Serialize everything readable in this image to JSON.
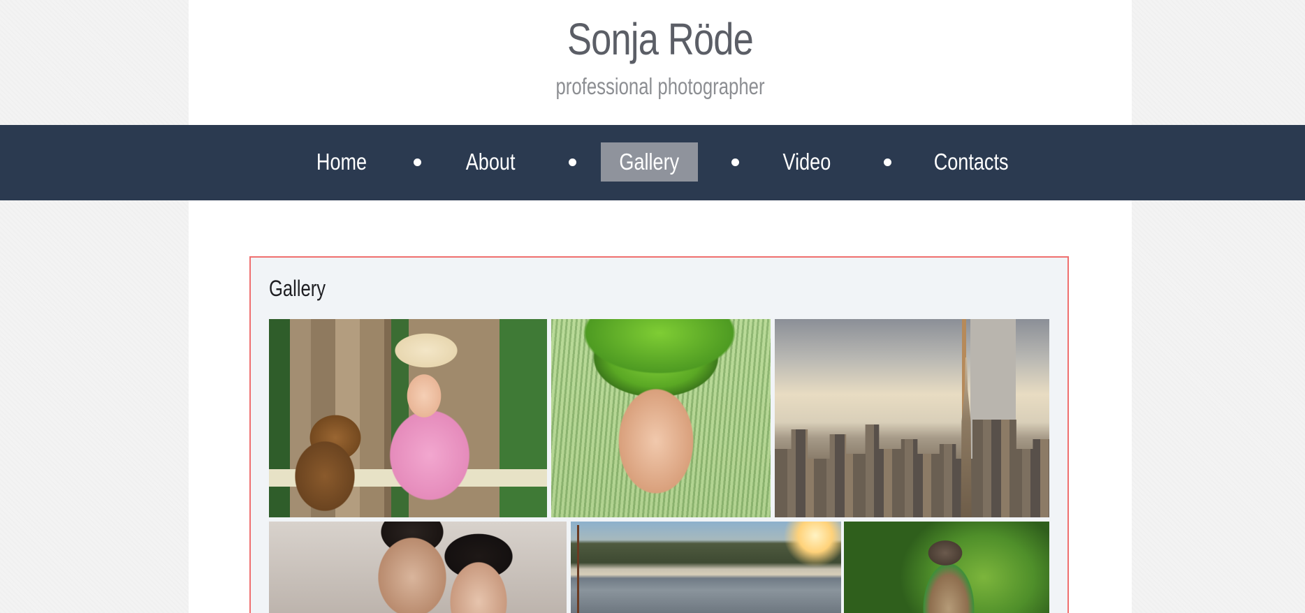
{
  "header": {
    "title": "Sonja Röde",
    "subtitle": "professional photographer"
  },
  "nav": {
    "items": [
      {
        "label": "Home"
      },
      {
        "label": "About"
      },
      {
        "label": "Gallery",
        "active": true
      },
      {
        "label": "Video"
      },
      {
        "label": "Contacts"
      }
    ]
  },
  "gallery": {
    "title": "Gallery",
    "photos": [
      {
        "subject": "girl-reading-with-teddy-bear"
      },
      {
        "subject": "woman-with-grass-hair"
      },
      {
        "subject": "city-skyline"
      },
      {
        "subject": "couple-portrait"
      },
      {
        "subject": "harbor-at-sunset"
      },
      {
        "subject": "parrot"
      }
    ]
  },
  "colors": {
    "nav_background": "#2b3a50",
    "nav_active": "#8f939c",
    "gallery_border": "#ef6f6f",
    "gallery_background": "#f1f4f7",
    "title_text": "#5b5e66",
    "subtitle_text": "#8c8e92"
  }
}
